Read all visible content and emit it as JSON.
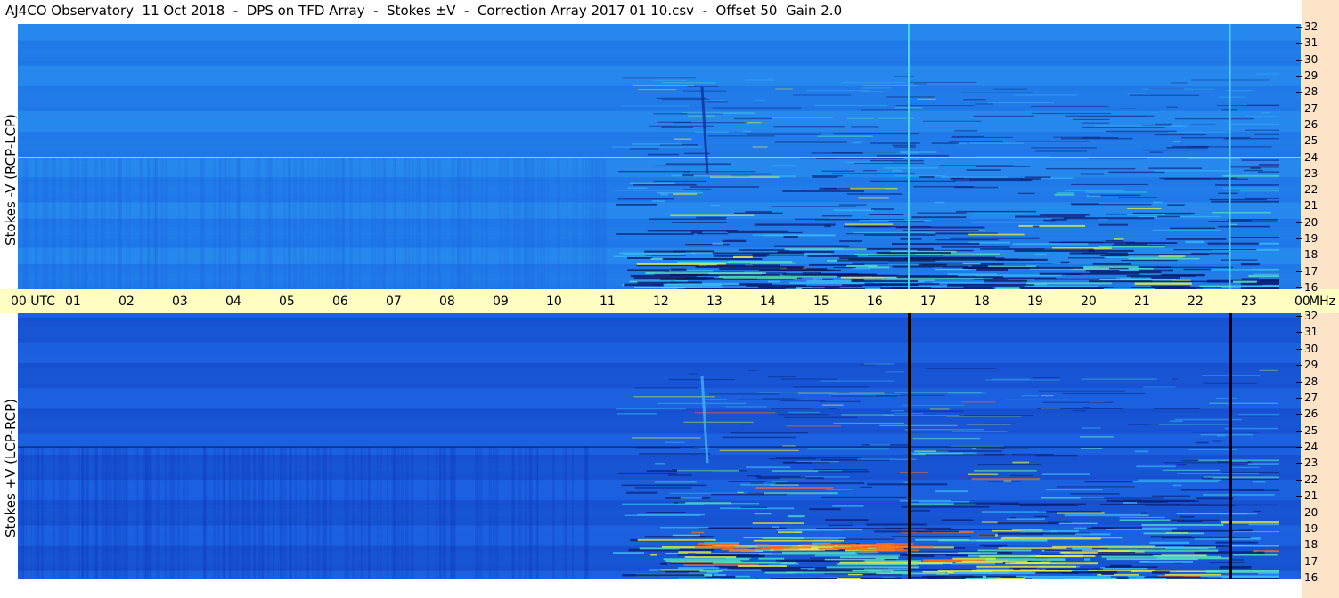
{
  "title": "AJ4CO Observatory  11 Oct 2018  -  DPS on TFD Array  -  Stokes ±V  -  Correction Array 2017 01 10.csv  -  Offset 50  Gain 2.0",
  "chart_data": [
    {
      "type": "heatmap",
      "panel": "upper",
      "ylabel": "Stokes -V (RCP-LCP)",
      "x_axis": {
        "unit": "UTC",
        "ticks": [
          "00 UTC",
          "01",
          "02",
          "03",
          "04",
          "05",
          "06",
          "07",
          "08",
          "09",
          "10",
          "11",
          "12",
          "13",
          "14",
          "15",
          "16",
          "17",
          "18",
          "19",
          "20",
          "21",
          "22",
          "23",
          "00"
        ],
        "range_hours": [
          0,
          24
        ]
      },
      "y_axis": {
        "unit": "MHz",
        "ticks": [
          "16",
          "17",
          "18",
          "19",
          "20",
          "21",
          "22",
          "23",
          "24",
          "25",
          "26",
          "27",
          "28",
          "29",
          "30",
          "31",
          "32"
        ],
        "range_mhz": [
          16,
          32
        ]
      },
      "colormap": [
        "#0b2fb8",
        "#1a5ee0",
        "#2a8cf0",
        "#38b7f5",
        "#55e0c0",
        "#e8f23c",
        "#ff6a1a",
        "#e01010"
      ],
      "features": {
        "vertical_lines_hours": [
          16.65,
          22.65
        ],
        "vertical_line_color": "#4ad4e8",
        "horizontal_line_mhz": 24.0,
        "horizontal_line_color": "#7fe0f0",
        "burst_hour": 12.9,
        "activity_start_hour": 11.1
      }
    },
    {
      "type": "heatmap",
      "panel": "lower",
      "ylabel": "Stokes +V (LCP-RCP)",
      "x_axis": {
        "unit": "UTC",
        "ticks": [
          "00 UTC",
          "01",
          "02",
          "03",
          "04",
          "05",
          "06",
          "07",
          "08",
          "09",
          "10",
          "11",
          "12",
          "13",
          "14",
          "15",
          "16",
          "17",
          "18",
          "19",
          "20",
          "21",
          "22",
          "23",
          "00"
        ],
        "range_hours": [
          0,
          24
        ]
      },
      "y_axis": {
        "unit": "MHz",
        "ticks": [
          "16",
          "17",
          "18",
          "19",
          "20",
          "21",
          "22",
          "23",
          "24",
          "25",
          "26",
          "27",
          "28",
          "29",
          "30",
          "31",
          "32"
        ],
        "range_mhz": [
          16,
          32
        ]
      },
      "colormap": [
        "#0b2fb8",
        "#1a5ee0",
        "#2a8cf0",
        "#38b7f5",
        "#55e0c0",
        "#e8f23c",
        "#ff6a1a",
        "#e01010"
      ],
      "features": {
        "vertical_lines_hours": [
          16.65,
          22.65
        ],
        "vertical_line_color": "#000000",
        "horizontal_line_mhz": 24.0,
        "horizontal_line_color": "#0a1a60",
        "burst_hour": 12.9,
        "activity_start_hour": 11.1
      }
    }
  ],
  "utc_axis_labels": [
    "00 UTC",
    "01",
    "02",
    "03",
    "04",
    "05",
    "06",
    "07",
    "08",
    "09",
    "10",
    "11",
    "12",
    "13",
    "14",
    "15",
    "16",
    "17",
    "18",
    "19",
    "20",
    "21",
    "22",
    "23",
    "00"
  ],
  "mhz_label": "MHz",
  "freq_labels": [
    "32",
    "31",
    "30",
    "29",
    "28",
    "27",
    "26",
    "25",
    "24",
    "23",
    "22",
    "21",
    "20",
    "19",
    "18",
    "17",
    "16"
  ]
}
